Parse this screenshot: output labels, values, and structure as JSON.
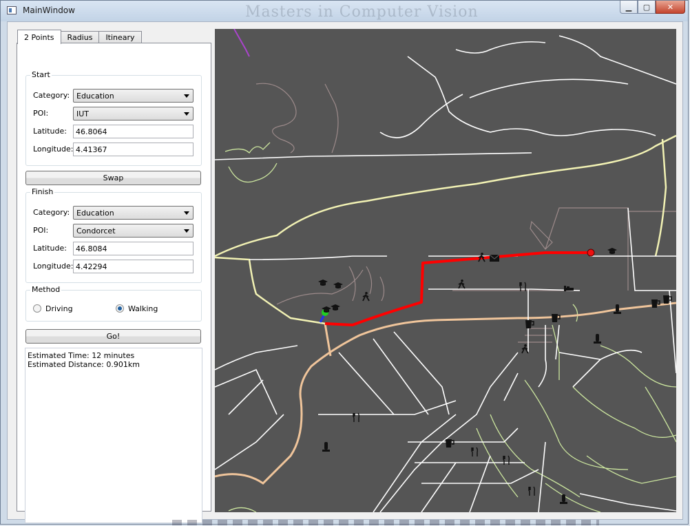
{
  "window": {
    "title": "MainWindow",
    "background_title": "Masters in Computer Vision",
    "minimize_symbol": "▁",
    "maximize_symbol": "▢",
    "close_symbol": "✕"
  },
  "tabs": [
    {
      "label": "2 Points",
      "active": true
    },
    {
      "label": "Radius",
      "active": false
    },
    {
      "label": "Itineary",
      "active": false
    }
  ],
  "start": {
    "group_title": "Start",
    "category_label": "Category:",
    "category_value": "Education",
    "poi_label": "POI:",
    "poi_value": "IUT",
    "latitude_label": "Latitude:",
    "latitude_value": "46.8064",
    "longitude_label": "Longitude:",
    "longitude_value": "4.41367"
  },
  "swap_label": "Swap",
  "finish": {
    "group_title": "Finish",
    "category_label": "Category:",
    "category_value": "Education",
    "poi_label": "POI:",
    "poi_value": "Condorcet",
    "latitude_label": "Latitude:",
    "latitude_value": "46.8084",
    "longitude_label": "Longitude:",
    "longitude_value": "4.42294"
  },
  "method": {
    "group_title": "Method",
    "options": [
      {
        "label": "Driving",
        "selected": false
      },
      {
        "label": "Walking",
        "selected": true
      }
    ]
  },
  "go_label": "Go!",
  "results": {
    "time_line": "Estimated Time: 12 minutes",
    "distance_line": "Estimated Distance: 0.901km"
  },
  "map": {
    "icons": [
      "graduation-cap-icon",
      "walking-person-icon",
      "mail-icon",
      "restaurant-icon",
      "hotel-bed-icon",
      "monument-icon",
      "fuel-pump-icon",
      "bar-drink-icon",
      "cycling-icon",
      "memorial-icon"
    ],
    "colors": {
      "background": "#555555",
      "route": "#ff0000",
      "start_marker": "#22cc22",
      "finish_marker": "#ee1111",
      "main_road": "#f5c9a0",
      "secondary_road": "#ffffcc",
      "minor_road": "#ffffff",
      "footpath": "#cc9999",
      "green_path": "#ccee99",
      "boundary": "#aa44cc"
    }
  }
}
